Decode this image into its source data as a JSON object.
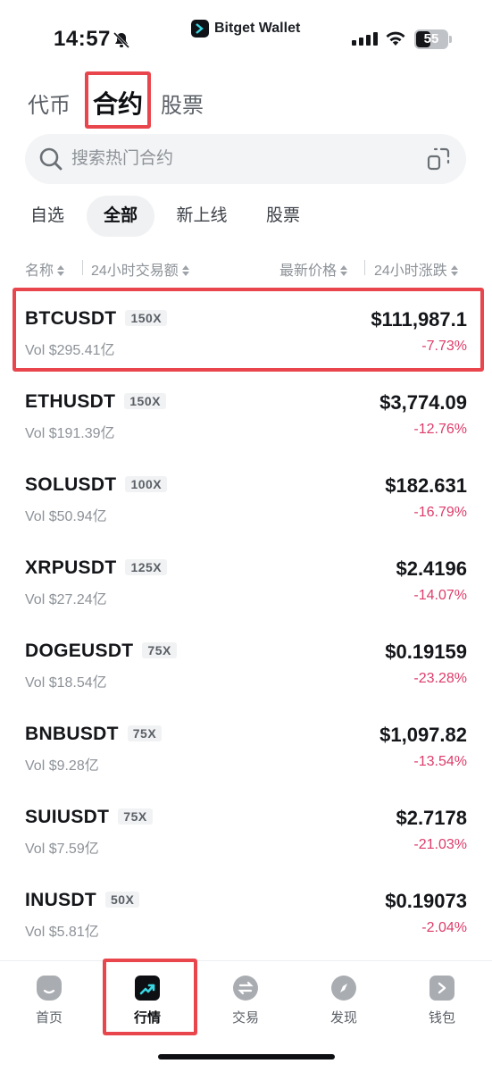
{
  "status_bar": {
    "time": "14:57",
    "brand": "Bitget Wallet",
    "battery": "55"
  },
  "main_tabs": [
    {
      "label": "代币",
      "active": false
    },
    {
      "label": "合约",
      "active": true
    },
    {
      "label": "股票",
      "active": false
    }
  ],
  "search": {
    "placeholder": "搜索热门合约"
  },
  "filter_tabs": [
    {
      "label": "自选",
      "active": false
    },
    {
      "label": "全部",
      "active": true
    },
    {
      "label": "新上线",
      "active": false
    },
    {
      "label": "股票",
      "active": false
    }
  ],
  "columns": {
    "name": "名称",
    "volume": "24小时交易额",
    "price": "最新价格",
    "change": "24小时涨跌"
  },
  "rows": [
    {
      "symbol": "BTCUSDT",
      "leverage": "150X",
      "volume": "Vol $295.41亿",
      "price": "$111,987.1",
      "change": "-7.73%"
    },
    {
      "symbol": "ETHUSDT",
      "leverage": "150X",
      "volume": "Vol $191.39亿",
      "price": "$3,774.09",
      "change": "-12.76%"
    },
    {
      "symbol": "SOLUSDT",
      "leverage": "100X",
      "volume": "Vol $50.94亿",
      "price": "$182.631",
      "change": "-16.79%"
    },
    {
      "symbol": "XRPUSDT",
      "leverage": "125X",
      "volume": "Vol $27.24亿",
      "price": "$2.4196",
      "change": "-14.07%"
    },
    {
      "symbol": "DOGEUSDT",
      "leverage": "75X",
      "volume": "Vol $18.54亿",
      "price": "$0.19159",
      "change": "-23.28%"
    },
    {
      "symbol": "BNBUSDT",
      "leverage": "75X",
      "volume": "Vol $9.28亿",
      "price": "$1,097.82",
      "change": "-13.54%"
    },
    {
      "symbol": "SUIUSDT",
      "leverage": "75X",
      "volume": "Vol $7.59亿",
      "price": "$2.7178",
      "change": "-21.03%"
    },
    {
      "symbol": "INUSDT",
      "leverage": "50X",
      "volume": "Vol $5.81亿",
      "price": "$0.19073",
      "change": "-2.04%"
    }
  ],
  "bottom_nav": [
    {
      "label": "首页",
      "icon": "home-icon",
      "active": false
    },
    {
      "label": "行情",
      "icon": "market-chart-icon",
      "active": true
    },
    {
      "label": "交易",
      "icon": "swap-icon",
      "active": false
    },
    {
      "label": "发现",
      "icon": "compass-icon",
      "active": false
    },
    {
      "label": "钱包",
      "icon": "wallet-icon",
      "active": false
    }
  ],
  "colors": {
    "accent_dark": "#0d0f12",
    "negative": "#dd3c6a",
    "highlight_border": "#e8464c",
    "muted_text": "#8d9298"
  }
}
